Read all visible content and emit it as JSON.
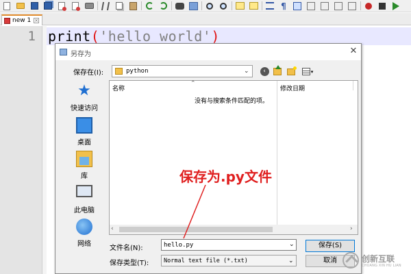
{
  "toolbar": {
    "buttons": [
      "new-file",
      "open-file",
      "save",
      "save-all",
      "close",
      "close-all",
      "print",
      "cut",
      "copy",
      "paste",
      "undo",
      "redo",
      "find",
      "replace",
      "zoom-in",
      "zoom-out",
      "sync-vertical",
      "sync-horizontal",
      "word-wrap",
      "show-all-chars",
      "indent-guide",
      "user-language",
      "document-map",
      "function-list",
      "monitoring",
      "record-macro",
      "stop-recording",
      "playback-macro"
    ]
  },
  "tab": {
    "label": "new 1"
  },
  "editor": {
    "line_number": "1",
    "code": {
      "func": "print",
      "open_paren": "(",
      "string": "'hello world'",
      "close_paren": ")"
    }
  },
  "dialog": {
    "title": "另存为",
    "save_in_label": "保存在(I):",
    "save_in_value": "python",
    "places": [
      "快速访问",
      "桌面",
      "库",
      "此电脑",
      "网络"
    ],
    "columns": {
      "name": "名称",
      "date": "修改日期"
    },
    "empty_message": "没有与搜索条件匹配的项。",
    "file_name_label": "文件名(N):",
    "file_name_value": "hello.py",
    "file_type_label": "保存类型(T):",
    "file_type_value": "Normal text file (*.txt)",
    "save_button": "保存(S)",
    "cancel_button": "取消"
  },
  "annotation": {
    "text": "保存为.py文件",
    "color": "#e02020"
  },
  "watermark": {
    "text": "创新互联",
    "sub": "CHUANG XIN HU LIAN"
  },
  "colors": {
    "accent": "#e08a2c",
    "current_line": "#e8e8ff",
    "paren": "#e01010",
    "string": "#808080",
    "focus": "#0078d7"
  }
}
